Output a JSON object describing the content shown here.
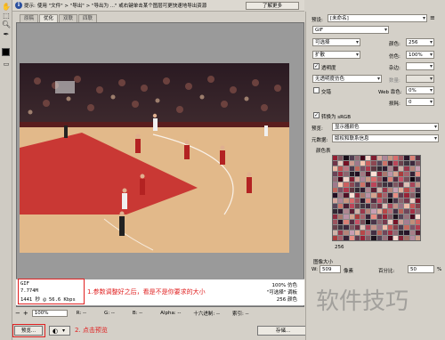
{
  "hint": {
    "prefix": "提示:",
    "text": "使用 \"文件\" > \"导出\" > \"导出为 ...\" 或右键单击某个图层可更快速地导出资源",
    "learn_more": "了解更多"
  },
  "tabs": [
    {
      "label": "原稿"
    },
    {
      "label": "优化"
    },
    {
      "label": "双联"
    },
    {
      "label": "四联"
    }
  ],
  "image_info": {
    "format": "GIF",
    "size": "7.774M",
    "time": "1441 秒 @ 56.6 Kbps",
    "quality": "100% 仿色",
    "palette": "\"可选择\" 调板",
    "colors": "256 颜色"
  },
  "annotations": {
    "step1": "1.参数调整好之后，看是不是你要求的大小",
    "step2": "2. 点击预览"
  },
  "status": {
    "zoom": "100%",
    "r": "R: --",
    "g": "G: --",
    "b": "B: --",
    "alpha": "Alpha: --",
    "hex": "十六进制: --",
    "index": "索引: --"
  },
  "buttons": {
    "preview": "预览...",
    "save": "存储..."
  },
  "panel": {
    "preset_label": "预设:",
    "preset_value": "[未命名]",
    "format": "GIF",
    "reduction": "可选择",
    "dither_algo": "扩散",
    "colors_label": "颜色:",
    "colors_value": "256",
    "dither_label": "仿色:",
    "dither_value": "100%",
    "transparency_label": "透明度",
    "matte_label": "杂边:",
    "transparency_dither": "无透明度仿色",
    "amount_label": "数量:",
    "interlaced_label": "交错",
    "websnap_label": "Web 靠色:",
    "websnap_value": "0%",
    "lossy_label": "损耗:",
    "lossy_value": "0",
    "convert_srgb": "转换为 sRGB",
    "preview_label": "预览:",
    "preview_value": "显示器颜色",
    "metadata_label": "元数据:",
    "metadata_value": "版权和联系信息",
    "colortable_label": "颜色表",
    "color_count": "256",
    "imagesize_label": "图像大小",
    "width_label": "W:",
    "width_value": "509",
    "width_unit": "像素",
    "percent_label": "百分比:",
    "percent_value": "50",
    "percent_unit": "%"
  },
  "watermark": "软件技巧",
  "colors": {
    "annotation_red": "#e02020",
    "court_floor": "#e2b98a",
    "paint_red": "#c62a2a"
  }
}
